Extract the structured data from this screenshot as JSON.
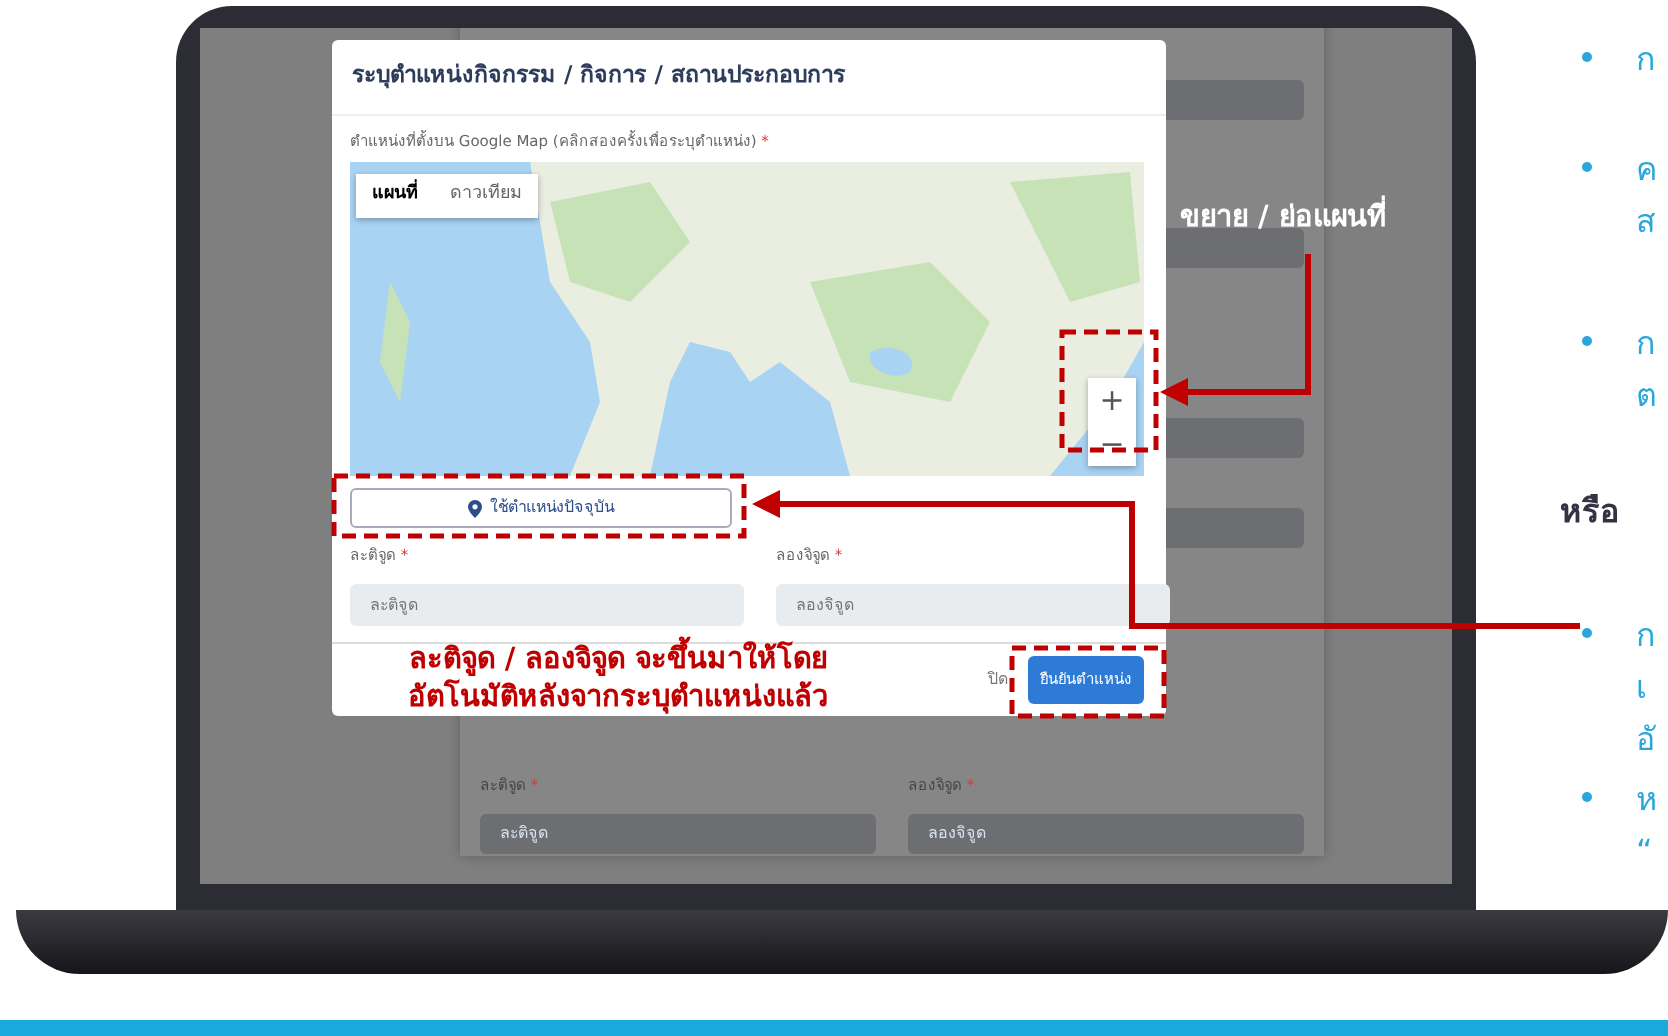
{
  "screen": {
    "background_form": {
      "fields": [
        {
          "label": "ละติจูด",
          "required_mark": "*",
          "placeholder": "ละติจูด"
        },
        {
          "label": "ลองจิจูด",
          "required_mark": "*",
          "placeholder": "ลองจิจูด"
        }
      ]
    },
    "modal": {
      "title": "ระบุตำแหน่งกิจกรรม / กิจการ / สถานประกอบการ",
      "map_label": "ตำแหน่งที่ตั้งบน Google Map (คลิกสองครั้งเพื่อระบุตำแหน่ง)",
      "map_required_mark": "*",
      "map_types": [
        {
          "label": "แผนที่",
          "selected": true
        },
        {
          "label": "ดาวเทียม",
          "selected": false
        }
      ],
      "zoom_buttons": [
        "+",
        "−"
      ],
      "locate_button": "ใช้ตำแหน่งปัจจุบัน",
      "fields": [
        {
          "label": "ละติจูด",
          "required_mark": "*",
          "placeholder": "ละติจูด"
        },
        {
          "label": "ลองจิจูด",
          "required_mark": "*",
          "placeholder": "ลองจิจูด"
        }
      ],
      "footer_buttons": [
        {
          "label": "ปิด",
          "kind": "link"
        },
        {
          "label": "ยืนยันตำแหน่ง",
          "kind": "primary"
        }
      ]
    }
  },
  "annotations": {
    "zoom_callout": "ขยาย / ย่อแผนที่",
    "auto_fill_note": [
      "ละติจูด / ลองจิจูด จะขึ้นมาให้โดย",
      "อัตโนมัติหลังจากระบุตำแหน่งแล้ว"
    ]
  },
  "side_text": [
    {
      "kind": "bullet",
      "lines": [
        "ก"
      ]
    },
    {
      "kind": "bullet",
      "lines": [
        "ค",
        "ส"
      ]
    },
    {
      "kind": "bullet",
      "lines": [
        "ก",
        "ต"
      ]
    },
    {
      "kind": "heading",
      "lines": [
        "หรือ"
      ]
    },
    {
      "kind": "bullet",
      "lines": [
        "ก",
        "เ",
        "อั"
      ]
    },
    {
      "kind": "bullet",
      "lines": [
        "ห",
        "“"
      ]
    }
  ]
}
